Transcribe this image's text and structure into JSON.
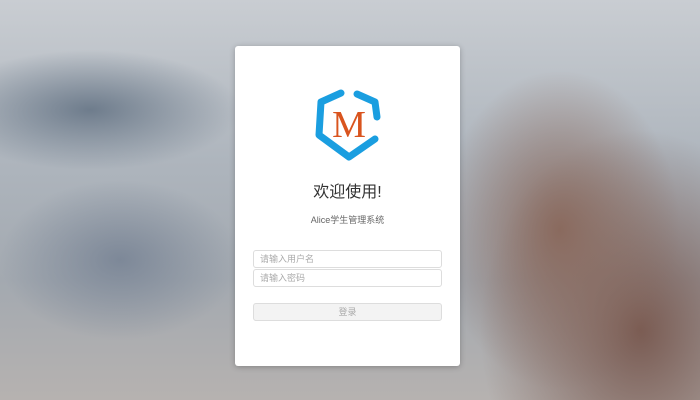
{
  "logo": {
    "letter": "M",
    "ring_color": "#1a9ee0",
    "letter_color": "#d9541e"
  },
  "title": "欢迎使用!",
  "subtitle": "Alice学生管理系统",
  "username": {
    "value": "",
    "placeholder": "请输入用户名"
  },
  "password": {
    "value": "",
    "placeholder": "请输入密码"
  },
  "login_label": "登录"
}
